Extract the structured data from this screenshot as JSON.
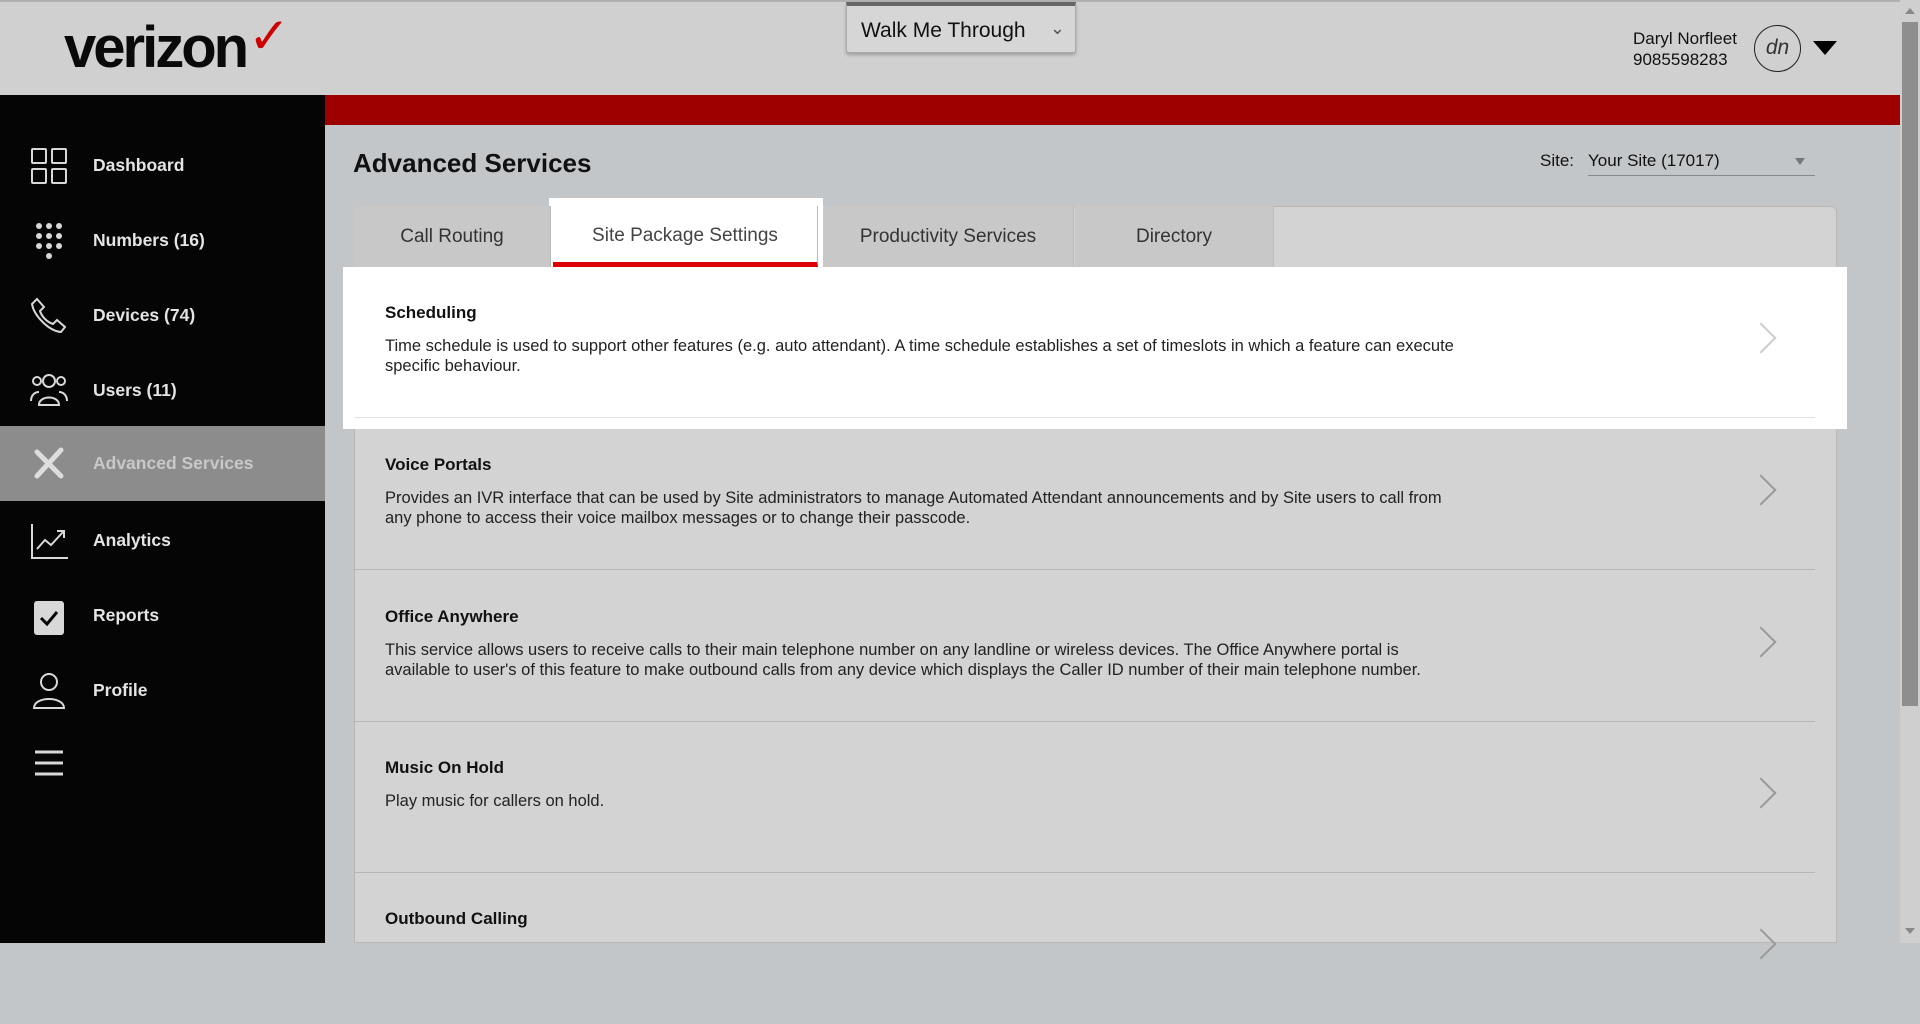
{
  "header": {
    "logo": "verizon",
    "walkme_label": "Walk Me Through",
    "user_name": "Daryl Norfleet",
    "user_phone": "9085598283",
    "avatar_initials": "dn"
  },
  "colors": {
    "brand_red": "#9e0000",
    "tab_underline": "#dd0000",
    "sidebar_bg": "#050505",
    "active_item": "#8c8c8c"
  },
  "sidebar": {
    "items": [
      {
        "label": "Dashboard",
        "icon": "grid-icon"
      },
      {
        "label": "Numbers (16)",
        "icon": "keypad-icon"
      },
      {
        "label": "Devices (74)",
        "icon": "phone-icon"
      },
      {
        "label": "Users (11)",
        "icon": "users-icon"
      },
      {
        "label": "Advanced Services",
        "icon": "tools-icon",
        "active": true
      },
      {
        "label": "Analytics",
        "icon": "chart-icon"
      },
      {
        "label": "Reports",
        "icon": "clipboard-check-icon"
      },
      {
        "label": "Profile",
        "icon": "person-icon"
      }
    ],
    "menu_icon": "hamburger-icon"
  },
  "main": {
    "title": "Advanced Services",
    "site_label": "Site:",
    "site_value": "Your Site (17017)",
    "tabs": [
      {
        "label": "Call Routing"
      },
      {
        "label": "Site Package Settings",
        "active": true
      },
      {
        "label": "Productivity Services"
      },
      {
        "label": "Directory"
      }
    ],
    "services": [
      {
        "title": "Scheduling",
        "description": "Time schedule is used to support other features (e.g. auto attendant). A time schedule establishes a set of timeslots in which a feature can execute specific behaviour."
      },
      {
        "title": "Voice Portals",
        "description": "Provides an IVR interface that can be used by Site administrators to manage Automated Attendant announcements and by Site users to call from any phone to access their voice mailbox messages or to change their passcode."
      },
      {
        "title": "Office Anywhere",
        "description": "This service allows users to receive calls to their main telephone number on any landline or wireless devices. The Office Anywhere portal is available to user's of this feature to make outbound calls from any device which displays the Caller ID number of their main telephone number."
      },
      {
        "title": "Music On Hold",
        "description": "Play music for callers on hold."
      },
      {
        "title": "Outbound Calling",
        "description": ""
      }
    ]
  }
}
